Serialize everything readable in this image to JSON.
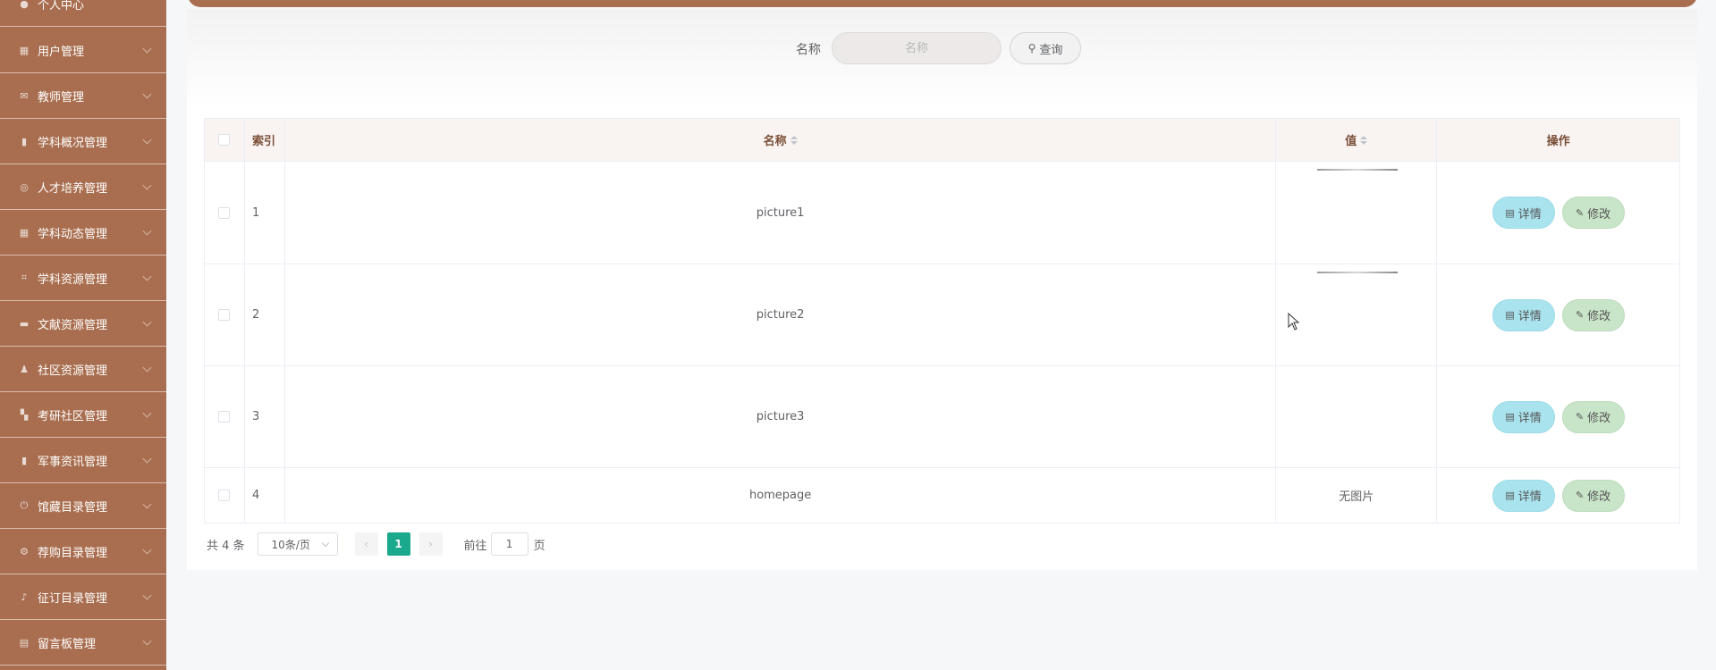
{
  "sidebar": {
    "items": [
      {
        "label": "个人中心",
        "icon": "user-icon"
      },
      {
        "label": "用户管理",
        "icon": "building-icon"
      },
      {
        "label": "教师管理",
        "icon": "mail-icon"
      },
      {
        "label": "学科概况管理",
        "icon": "bar-chart-icon"
      },
      {
        "label": "人才培养管理",
        "icon": "globe-icon"
      },
      {
        "label": "学科动态管理",
        "icon": "grid-icon"
      },
      {
        "label": "学科资源管理",
        "icon": "crop-icon"
      },
      {
        "label": "文献资源管理",
        "icon": "briefcase-icon"
      },
      {
        "label": "社区资源管理",
        "icon": "person-icon"
      },
      {
        "label": "考研社区管理",
        "icon": "apps-icon"
      },
      {
        "label": "军事资讯管理",
        "icon": "chart-icon"
      },
      {
        "label": "馆藏目录管理",
        "icon": "power-icon"
      },
      {
        "label": "荐购目录管理",
        "icon": "gear-icon"
      },
      {
        "label": "征订目录管理",
        "icon": "mic-icon"
      },
      {
        "label": "留言板管理",
        "icon": "printer-icon"
      }
    ]
  },
  "search": {
    "label": "名称",
    "placeholder": "名称",
    "button_label": "查询"
  },
  "table": {
    "headers": {
      "index": "索引",
      "name": "名称",
      "value": "值",
      "ops": "操作"
    },
    "rows": [
      {
        "index": "1",
        "name": "picture1",
        "value": ""
      },
      {
        "index": "2",
        "name": "picture2",
        "value": ""
      },
      {
        "index": "3",
        "name": "picture3",
        "value": ""
      },
      {
        "index": "4",
        "name": "homepage",
        "value": "无图片"
      }
    ],
    "detail_label": "详情",
    "edit_label": "修改"
  },
  "pagination": {
    "total_text": "共 4 条",
    "page_size": "10条/页",
    "current_page": "1",
    "goto_label": "前往",
    "goto_value": "1",
    "page_suffix": "页"
  },
  "colors": {
    "sidebar_bg": "#a96e4f",
    "accent": "#1aa98d",
    "detail_btn": "#a9e3ee",
    "edit_btn": "#c9e5c9"
  }
}
